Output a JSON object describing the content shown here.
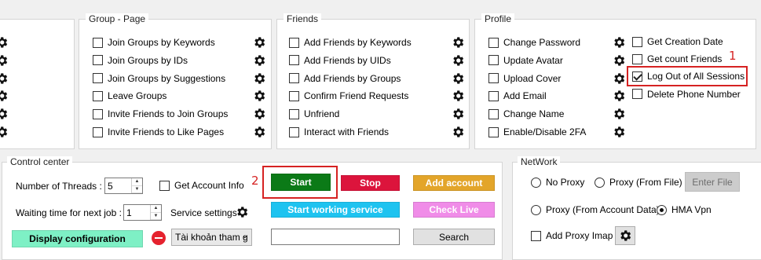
{
  "groups": {
    "group_page": {
      "title": "Group - Page",
      "items": [
        "Join Groups by Keywords",
        "Join Groups by IDs",
        "Join Groups by Suggestions",
        "Leave Groups",
        "Invite Friends to Join Groups",
        "Invite Friends to Like Pages"
      ]
    },
    "friends": {
      "title": "Friends",
      "items": [
        "Add Friends by Keywords",
        "Add Friends by UIDs",
        "Add Friends by  Groups",
        "Confirm Friend Requests",
        "Unfriend",
        "Interact with Friends"
      ]
    },
    "profile": {
      "title": "Profile",
      "items": [
        "Change Password",
        "Update Avatar",
        "Upload Cover",
        "Add Email",
        "Change Name",
        "Enable/Disable 2FA"
      ],
      "extra_items": [
        "Get Creation Date",
        "Get count Friends",
        "Log Out of All Sessions",
        "Delete Phone Number"
      ],
      "checked_extra": 2
    }
  },
  "control_center": {
    "title": "Control center",
    "threads_label": "Number of Threads :",
    "threads_value": "5",
    "get_account_info": "Get Account Info",
    "wait_label": "Waiting time for next job :",
    "wait_value": "1",
    "service_settings": "Service settings",
    "display_config": "Display configuration",
    "dropdown_value": "Tài khoản tham g",
    "start": "Start",
    "stop": "Stop",
    "add_account": "Add account",
    "start_service": "Start working service",
    "check_live": "Check Live",
    "search_value": "",
    "search_btn": "Search"
  },
  "network": {
    "title": "NetWork",
    "no_proxy": "No Proxy",
    "proxy_file": "Proxy (From File)",
    "enter_file": "Enter File",
    "proxy_account": "Proxy (From Account Data)",
    "hma_vpn": "HMA Vpn",
    "add_proxy_imap": "Add Proxy Imap"
  },
  "annotations": {
    "one": "1",
    "two": "2"
  },
  "colors": {
    "start": "#0b7a17",
    "stop": "#dc143c",
    "add_account": "#e3a52a",
    "start_service": "#1ec3f0",
    "check_live": "#f08ce8",
    "display_config": "#7ef0c5",
    "highlight": "#d62222"
  }
}
